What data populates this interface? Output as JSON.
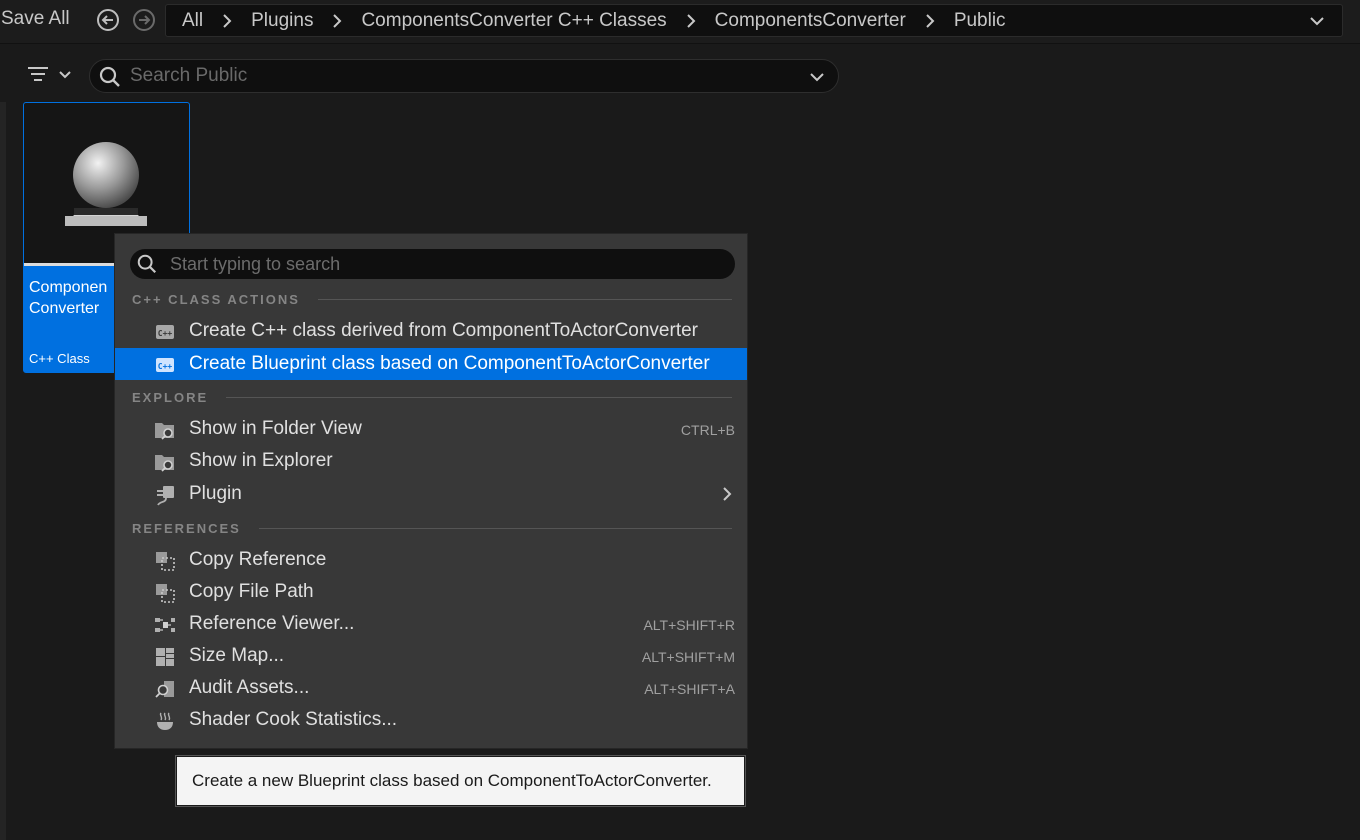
{
  "toolbar": {
    "save_all_label": "Save All",
    "back_icon": "back-arrow-icon",
    "forward_icon": "forward-arrow-icon"
  },
  "breadcrumb": {
    "items": [
      "All",
      "Plugins",
      "ComponentsConverter C++ Classes",
      "ComponentsConverter",
      "Public"
    ]
  },
  "filter": {
    "search_placeholder": "Search Public"
  },
  "asset": {
    "name_line1": "Componen",
    "name_line2": "Converter",
    "type": "C++ Class"
  },
  "context_menu": {
    "search_placeholder": "Start typing to search",
    "sections": [
      {
        "header": "C++ CLASS ACTIONS",
        "items": [
          {
            "label": "Create C++ class derived from ComponentToActorConverter",
            "icon": "cpp-class-icon",
            "shortcut": ""
          },
          {
            "label": "Create Blueprint class based on ComponentToActorConverter",
            "icon": "cpp-class-icon",
            "shortcut": "",
            "highlighted": true
          }
        ]
      },
      {
        "header": "EXPLORE",
        "items": [
          {
            "label": "Show in Folder View",
            "icon": "folder-search-icon",
            "shortcut": "CTRL+B"
          },
          {
            "label": "Show in Explorer",
            "icon": "folder-search-icon",
            "shortcut": ""
          },
          {
            "label": "Plugin",
            "icon": "plugin-icon",
            "shortcut": "",
            "submenu": true
          }
        ]
      },
      {
        "header": "REFERENCES",
        "items": [
          {
            "label": "Copy Reference",
            "icon": "copy-reference-icon",
            "shortcut": ""
          },
          {
            "label": "Copy File Path",
            "icon": "copy-file-path-icon",
            "shortcut": ""
          },
          {
            "label": "Reference Viewer...",
            "icon": "reference-viewer-icon",
            "shortcut": "ALT+SHIFT+R"
          },
          {
            "label": "Size Map...",
            "icon": "size-map-icon",
            "shortcut": "ALT+SHIFT+M"
          },
          {
            "label": "Audit Assets...",
            "icon": "audit-assets-icon",
            "shortcut": "ALT+SHIFT+A"
          },
          {
            "label": "Shader Cook Statistics...",
            "icon": "shader-cook-icon",
            "shortcut": ""
          }
        ]
      }
    ]
  },
  "tooltip": {
    "text": "Create a new Blueprint class based on ComponentToActorConverter."
  },
  "colors": {
    "accent": "#0070e0",
    "background": "#1a1a1a",
    "menu_bg": "#383838"
  }
}
